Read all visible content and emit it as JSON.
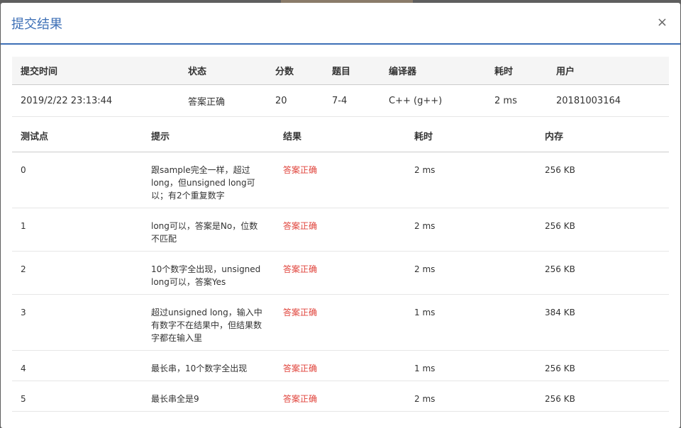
{
  "modal": {
    "title": "提交结果",
    "close_label": "×"
  },
  "summary": {
    "headers": [
      "提交时间",
      "状态",
      "分数",
      "题目",
      "编译器",
      "耗时",
      "用户"
    ],
    "row": {
      "time": "2019/2/22 23:13:44",
      "status": "答案正确",
      "score": "20",
      "problem": "7-4",
      "compiler": "C++ (g++)",
      "duration": "2 ms",
      "user": "20181003164"
    }
  },
  "cases": {
    "headers": [
      "测试点",
      "提示",
      "结果",
      "耗时",
      "内存"
    ],
    "rows": [
      {
        "id": "0",
        "hint": "跟sample完全一样，超过long，但unsigned long可以；有2个重复数字",
        "result": "答案正确",
        "time": "2 ms",
        "memory": "256 KB"
      },
      {
        "id": "1",
        "hint": "long可以，答案是No，位数不匹配",
        "result": "答案正确",
        "time": "2 ms",
        "memory": "256 KB"
      },
      {
        "id": "2",
        "hint": "10个数字全出现，unsigned long可以，答案Yes",
        "result": "答案正确",
        "time": "2 ms",
        "memory": "256 KB"
      },
      {
        "id": "3",
        "hint": "超过unsigned long，输入中有数字不在结果中，但结果数字都在输入里",
        "result": "答案正确",
        "time": "1 ms",
        "memory": "384 KB"
      },
      {
        "id": "4",
        "hint": "最长串，10个数字全出现",
        "result": "答案正确",
        "time": "1 ms",
        "memory": "256 KB"
      },
      {
        "id": "5",
        "hint": "最长串全是9",
        "result": "答案正确",
        "time": "2 ms",
        "memory": "256 KB"
      }
    ]
  },
  "colors": {
    "accent": "#3d6fb6",
    "success_red": "#e0433b"
  }
}
